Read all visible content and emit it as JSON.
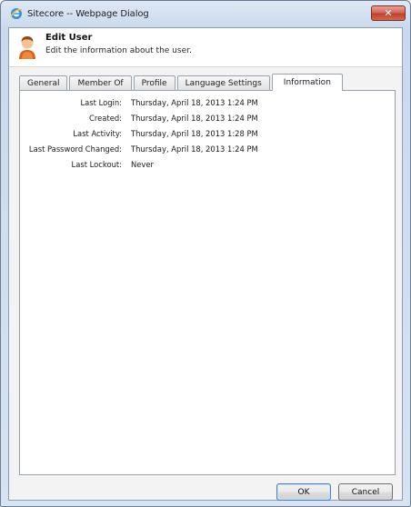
{
  "window": {
    "title": "Sitecore -- Webpage Dialog",
    "close_glyph": "✕"
  },
  "header": {
    "title": "Edit User",
    "subtitle": "Edit the information about the user."
  },
  "tabs": [
    {
      "label": "General",
      "active": false
    },
    {
      "label": "Member Of",
      "active": false
    },
    {
      "label": "Profile",
      "active": false
    },
    {
      "label": "Language Settings",
      "active": false
    },
    {
      "label": "Information",
      "active": true
    }
  ],
  "information": [
    {
      "label": "Last Login:",
      "value": "Thursday, April 18, 2013 1:24 PM"
    },
    {
      "label": "Created:",
      "value": "Thursday, April 18, 2013 1:24 PM"
    },
    {
      "label": "Last Activity:",
      "value": "Thursday, April 18, 2013 1:28 PM"
    },
    {
      "label": "Last Password Changed:",
      "value": "Thursday, April 18, 2013 1:24 PM"
    },
    {
      "label": "Last Lockout:",
      "value": "Never"
    }
  ],
  "buttons": {
    "ok": "OK",
    "cancel": "Cancel"
  },
  "icons": {
    "window": "internet-explorer-icon",
    "user": "user-icon",
    "close": "close-icon"
  },
  "colors": {
    "close_button": "#c1402f",
    "window_frame": "#cad9ec",
    "panel_background": "#ffffff"
  }
}
